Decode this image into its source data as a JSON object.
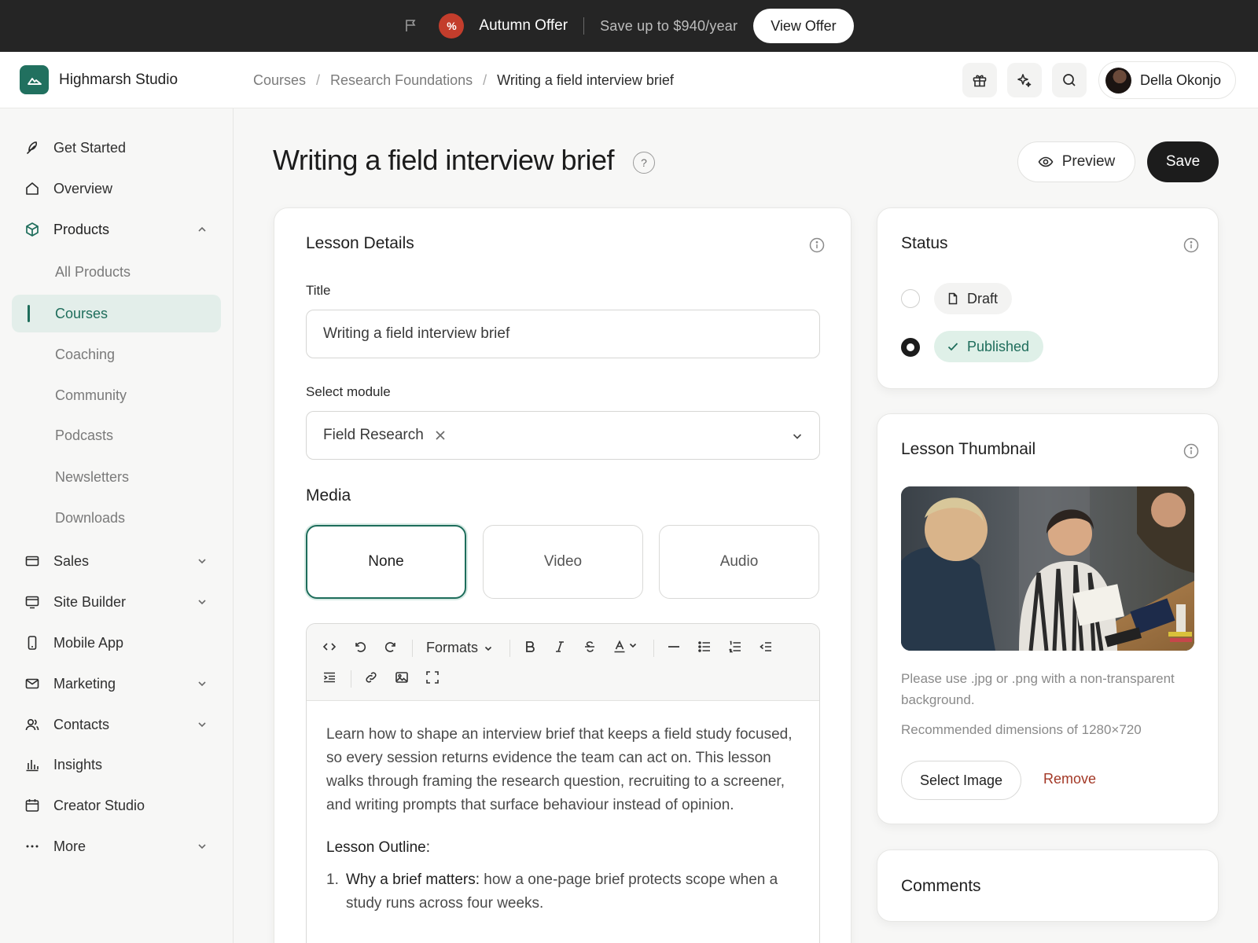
{
  "promo": {
    "offer_title": "Autumn Offer",
    "offer_text": "Save up to $940/year",
    "cta_label": "View Offer",
    "badge_symbol": "%"
  },
  "header": {
    "brand_name": "Highmarsh Studio",
    "breadcrumbs": [
      "Courses",
      "Research Foundations",
      "Writing a field interview brief"
    ],
    "user_name": "Della Okonjo"
  },
  "sidebar": {
    "items": [
      {
        "label": "Get Started",
        "icon": "feather-icon"
      },
      {
        "label": "Overview",
        "icon": "home-icon"
      },
      {
        "label": "Products",
        "icon": "box-icon",
        "expanded": true
      },
      {
        "label": "Sales",
        "icon": "card-icon"
      },
      {
        "label": "Site Builder",
        "icon": "monitor-icon"
      },
      {
        "label": "Mobile App",
        "icon": "phone-icon"
      },
      {
        "label": "Marketing",
        "icon": "mail-icon"
      },
      {
        "label": "Contacts",
        "icon": "users-icon"
      },
      {
        "label": "Insights",
        "icon": "bar-chart-icon"
      },
      {
        "label": "Creator Studio",
        "icon": "calendar-icon"
      },
      {
        "label": "More",
        "icon": "dots-icon"
      }
    ],
    "products_children": [
      "All Products",
      "Courses",
      "Coaching",
      "Community",
      "Podcasts",
      "Newsletters",
      "Downloads"
    ],
    "active_child": "Courses"
  },
  "page": {
    "title": "Writing a field interview brief",
    "help": "?",
    "preview_label": "Preview",
    "save_label": "Save"
  },
  "lesson_details": {
    "heading": "Lesson Details",
    "title_label": "Title",
    "title_value": "Writing a field interview brief",
    "module_label": "Select module",
    "module_value": "Field Research",
    "media_heading": "Media",
    "media_options": [
      "None",
      "Video",
      "Audio"
    ],
    "media_selected": "None",
    "toolbar": {
      "formats_label": "Formats"
    },
    "body_intro": "Learn how to shape an interview brief that keeps a field study focused, so every session returns evidence the team can act on. This lesson walks through framing the research question, recruiting to a screener, and writing prompts that surface behaviour instead of opinion.",
    "outline_heading": "Lesson Outline:",
    "outline": [
      {
        "num": "1.",
        "title": "Why a brief matters:",
        "text": " how a one-page brief protects scope when a study runs across four weeks."
      }
    ]
  },
  "status": {
    "heading": "Status",
    "options": [
      {
        "label": "Draft",
        "selected": false
      },
      {
        "label": "Published",
        "selected": true
      }
    ]
  },
  "thumbnail": {
    "heading": "Lesson Thumbnail",
    "note_1": "Please use .jpg or .png with a non-transparent background.",
    "note_2": "Recommended dimensions of 1280×720",
    "select_label": "Select Image",
    "remove_label": "Remove"
  },
  "comments": {
    "heading": "Comments"
  },
  "colors": {
    "accent": "#1e6d5b",
    "promo_bg": "#252525",
    "danger": "#a33826"
  }
}
